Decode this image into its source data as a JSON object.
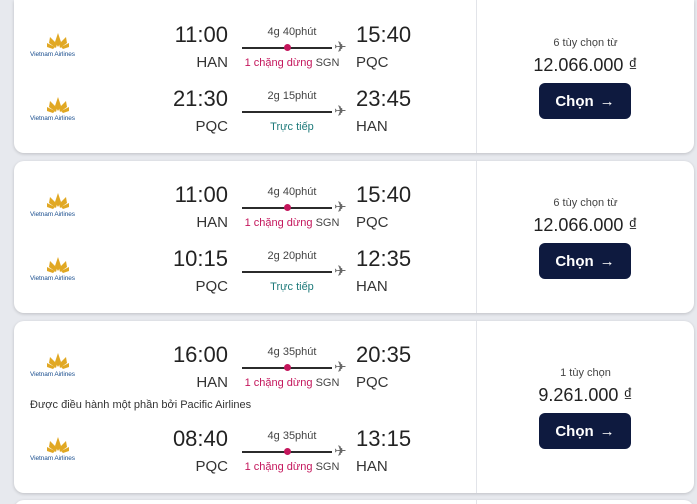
{
  "results": [
    {
      "legs": [
        {
          "airline": "Vietnam Airlines",
          "dep_time": "11:00",
          "dep_code": "HAN",
          "arr_time": "15:40",
          "arr_code": "PQC",
          "duration": "4g 40phút",
          "stops_count": "1 chặng dừng",
          "stops_airport": "SGN",
          "direct": false
        },
        {
          "airline": "Vietnam Airlines",
          "dep_time": "21:30",
          "dep_code": "PQC",
          "arr_time": "23:45",
          "arr_code": "HAN",
          "duration": "2g 15phút",
          "stops_label": "Trực tiếp",
          "direct": true
        }
      ],
      "options": "6 tùy chọn từ",
      "price": "12.066.000 ₫",
      "button": "Chọn"
    },
    {
      "legs": [
        {
          "airline": "Vietnam Airlines",
          "dep_time": "11:00",
          "dep_code": "HAN",
          "arr_time": "15:40",
          "arr_code": "PQC",
          "duration": "4g 40phút",
          "stops_count": "1 chặng dừng",
          "stops_airport": "SGN",
          "direct": false
        },
        {
          "airline": "Vietnam Airlines",
          "dep_time": "10:15",
          "dep_code": "PQC",
          "arr_time": "12:35",
          "arr_code": "HAN",
          "duration": "2g 20phút",
          "stops_label": "Trực tiếp",
          "direct": true
        }
      ],
      "options": "6 tùy chọn từ",
      "price": "12.066.000 ₫",
      "button": "Chọn"
    },
    {
      "legs": [
        {
          "airline": "Vietnam Airlines",
          "dep_time": "16:00",
          "dep_code": "HAN",
          "arr_time": "20:35",
          "arr_code": "PQC",
          "duration": "4g 35phút",
          "stops_count": "1 chặng dừng",
          "stops_airport": "SGN",
          "direct": false
        },
        {
          "airline": "Vietnam Airlines",
          "dep_time": "08:40",
          "dep_code": "PQC",
          "arr_time": "13:15",
          "arr_code": "HAN",
          "duration": "4g 35phút",
          "stops_count": "1 chặng dừng",
          "stops_airport": "SGN",
          "direct": false
        }
      ],
      "note": "Được điều hành một phần bởi Pacific Airlines",
      "options": "1 tùy chọn",
      "price": "9.261.000 ₫",
      "button": "Chọn"
    }
  ],
  "icons": {
    "plane": "plane-icon",
    "arrow": "arrow-right-icon",
    "logo": "vietnam-airlines-lotus-logo"
  },
  "colors": {
    "accent": "#c4165c",
    "button": "#0e1a3f",
    "direct": "#1d7a7a",
    "logo_gold": "#e1a823",
    "logo_blue": "#1b4f8f"
  }
}
